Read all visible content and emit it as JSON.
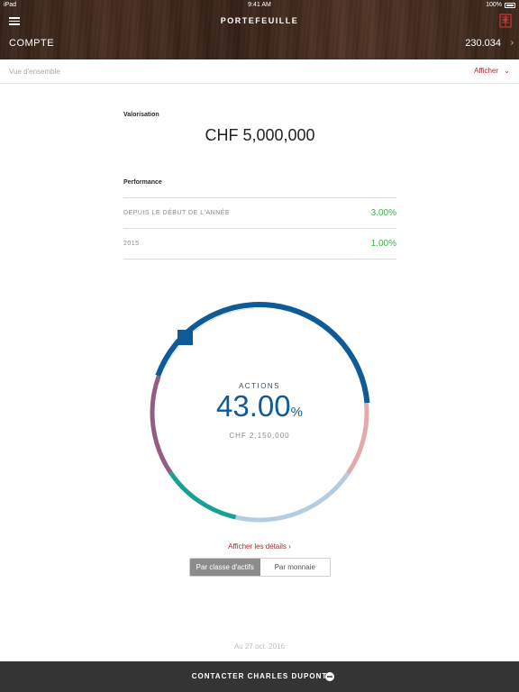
{
  "status_bar": {
    "device": "iPad",
    "time": "9:41 AM",
    "battery": "100%"
  },
  "header": {
    "title": "PORTEFEUILLE",
    "account_label": "COMPTE",
    "account_number": "230.034",
    "account_chevron": "›"
  },
  "subbar": {
    "overview": "Vue d'ensemble",
    "show_label": "Afficher",
    "show_chevron": "⌄"
  },
  "valuation": {
    "label": "Valorisation",
    "amount": "CHF 5,000,000"
  },
  "performance": {
    "label": "Performance",
    "rows": [
      {
        "label": "DEPUIS LE DÉBUT DE L'ANNÉE",
        "value": "3.00%"
      },
      {
        "label": "2015",
        "value": "1.00%"
      }
    ]
  },
  "allocation": {
    "selected_label": "ACTIONS",
    "selected_percent": "43.00",
    "percent_unit": "%",
    "selected_amount": "CHF 2,150,000",
    "colors": {
      "actions": "#0e5b97",
      "pink": "#e3a9ac",
      "lightblue": "#b3cde0",
      "teal": "#16a196",
      "purple": "#925e85"
    },
    "segments_fraction": [
      0.43,
      0.11,
      0.19,
      0.12,
      0.15
    ]
  },
  "details_link": "Afficher les détails  ›",
  "segmented": {
    "by_asset_class": "Par classe d'actifs",
    "by_currency": "Par monnaie"
  },
  "as_of": "Au 27 oct. 2016",
  "footer": {
    "contact_label": "CONTACTER CHARLES DUPONT"
  }
}
